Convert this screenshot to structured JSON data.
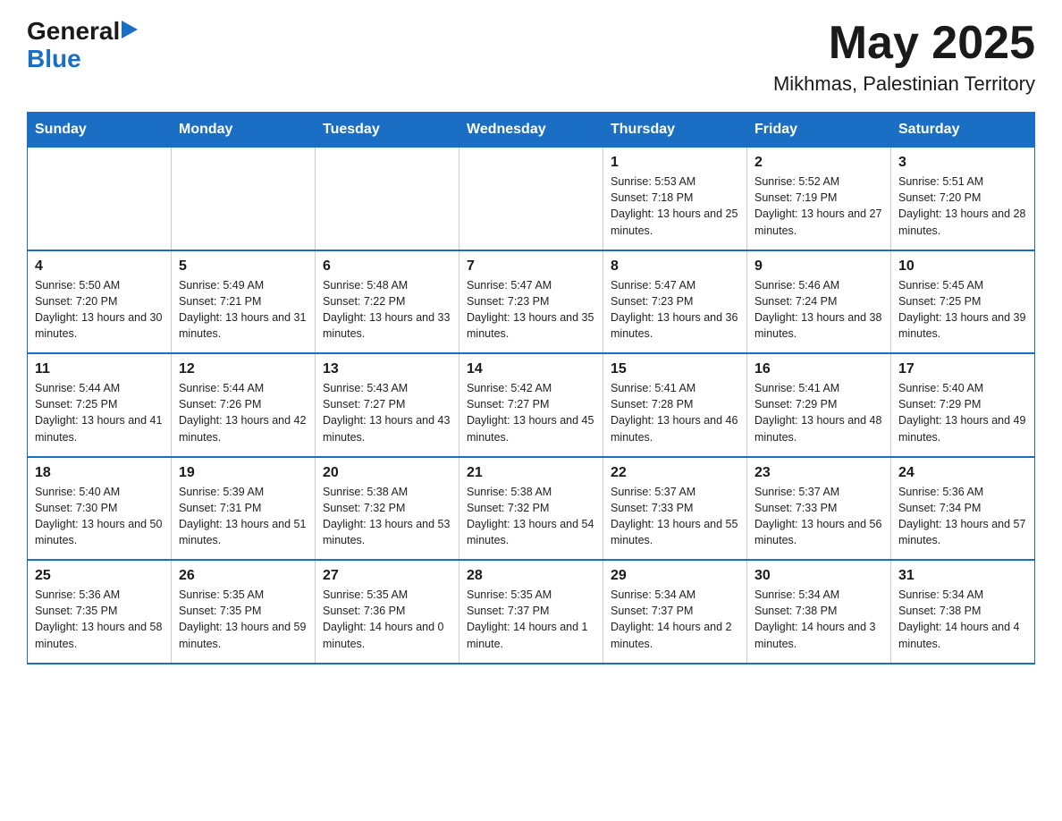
{
  "header": {
    "logo_general": "General",
    "logo_arrow": "▶",
    "logo_blue": "Blue",
    "month_title": "May 2025",
    "location": "Mikhmas, Palestinian Territory"
  },
  "columns": [
    "Sunday",
    "Monday",
    "Tuesday",
    "Wednesday",
    "Thursday",
    "Friday",
    "Saturday"
  ],
  "weeks": [
    [
      {
        "day": "",
        "info": ""
      },
      {
        "day": "",
        "info": ""
      },
      {
        "day": "",
        "info": ""
      },
      {
        "day": "",
        "info": ""
      },
      {
        "day": "1",
        "info": "Sunrise: 5:53 AM\nSunset: 7:18 PM\nDaylight: 13 hours and 25 minutes."
      },
      {
        "day": "2",
        "info": "Sunrise: 5:52 AM\nSunset: 7:19 PM\nDaylight: 13 hours and 27 minutes."
      },
      {
        "day": "3",
        "info": "Sunrise: 5:51 AM\nSunset: 7:20 PM\nDaylight: 13 hours and 28 minutes."
      }
    ],
    [
      {
        "day": "4",
        "info": "Sunrise: 5:50 AM\nSunset: 7:20 PM\nDaylight: 13 hours and 30 minutes."
      },
      {
        "day": "5",
        "info": "Sunrise: 5:49 AM\nSunset: 7:21 PM\nDaylight: 13 hours and 31 minutes."
      },
      {
        "day": "6",
        "info": "Sunrise: 5:48 AM\nSunset: 7:22 PM\nDaylight: 13 hours and 33 minutes."
      },
      {
        "day": "7",
        "info": "Sunrise: 5:47 AM\nSunset: 7:23 PM\nDaylight: 13 hours and 35 minutes."
      },
      {
        "day": "8",
        "info": "Sunrise: 5:47 AM\nSunset: 7:23 PM\nDaylight: 13 hours and 36 minutes."
      },
      {
        "day": "9",
        "info": "Sunrise: 5:46 AM\nSunset: 7:24 PM\nDaylight: 13 hours and 38 minutes."
      },
      {
        "day": "10",
        "info": "Sunrise: 5:45 AM\nSunset: 7:25 PM\nDaylight: 13 hours and 39 minutes."
      }
    ],
    [
      {
        "day": "11",
        "info": "Sunrise: 5:44 AM\nSunset: 7:25 PM\nDaylight: 13 hours and 41 minutes."
      },
      {
        "day": "12",
        "info": "Sunrise: 5:44 AM\nSunset: 7:26 PM\nDaylight: 13 hours and 42 minutes."
      },
      {
        "day": "13",
        "info": "Sunrise: 5:43 AM\nSunset: 7:27 PM\nDaylight: 13 hours and 43 minutes."
      },
      {
        "day": "14",
        "info": "Sunrise: 5:42 AM\nSunset: 7:27 PM\nDaylight: 13 hours and 45 minutes."
      },
      {
        "day": "15",
        "info": "Sunrise: 5:41 AM\nSunset: 7:28 PM\nDaylight: 13 hours and 46 minutes."
      },
      {
        "day": "16",
        "info": "Sunrise: 5:41 AM\nSunset: 7:29 PM\nDaylight: 13 hours and 48 minutes."
      },
      {
        "day": "17",
        "info": "Sunrise: 5:40 AM\nSunset: 7:29 PM\nDaylight: 13 hours and 49 minutes."
      }
    ],
    [
      {
        "day": "18",
        "info": "Sunrise: 5:40 AM\nSunset: 7:30 PM\nDaylight: 13 hours and 50 minutes."
      },
      {
        "day": "19",
        "info": "Sunrise: 5:39 AM\nSunset: 7:31 PM\nDaylight: 13 hours and 51 minutes."
      },
      {
        "day": "20",
        "info": "Sunrise: 5:38 AM\nSunset: 7:32 PM\nDaylight: 13 hours and 53 minutes."
      },
      {
        "day": "21",
        "info": "Sunrise: 5:38 AM\nSunset: 7:32 PM\nDaylight: 13 hours and 54 minutes."
      },
      {
        "day": "22",
        "info": "Sunrise: 5:37 AM\nSunset: 7:33 PM\nDaylight: 13 hours and 55 minutes."
      },
      {
        "day": "23",
        "info": "Sunrise: 5:37 AM\nSunset: 7:33 PM\nDaylight: 13 hours and 56 minutes."
      },
      {
        "day": "24",
        "info": "Sunrise: 5:36 AM\nSunset: 7:34 PM\nDaylight: 13 hours and 57 minutes."
      }
    ],
    [
      {
        "day": "25",
        "info": "Sunrise: 5:36 AM\nSunset: 7:35 PM\nDaylight: 13 hours and 58 minutes."
      },
      {
        "day": "26",
        "info": "Sunrise: 5:35 AM\nSunset: 7:35 PM\nDaylight: 13 hours and 59 minutes."
      },
      {
        "day": "27",
        "info": "Sunrise: 5:35 AM\nSunset: 7:36 PM\nDaylight: 14 hours and 0 minutes."
      },
      {
        "day": "28",
        "info": "Sunrise: 5:35 AM\nSunset: 7:37 PM\nDaylight: 14 hours and 1 minute."
      },
      {
        "day": "29",
        "info": "Sunrise: 5:34 AM\nSunset: 7:37 PM\nDaylight: 14 hours and 2 minutes."
      },
      {
        "day": "30",
        "info": "Sunrise: 5:34 AM\nSunset: 7:38 PM\nDaylight: 14 hours and 3 minutes."
      },
      {
        "day": "31",
        "info": "Sunrise: 5:34 AM\nSunset: 7:38 PM\nDaylight: 14 hours and 4 minutes."
      }
    ]
  ]
}
